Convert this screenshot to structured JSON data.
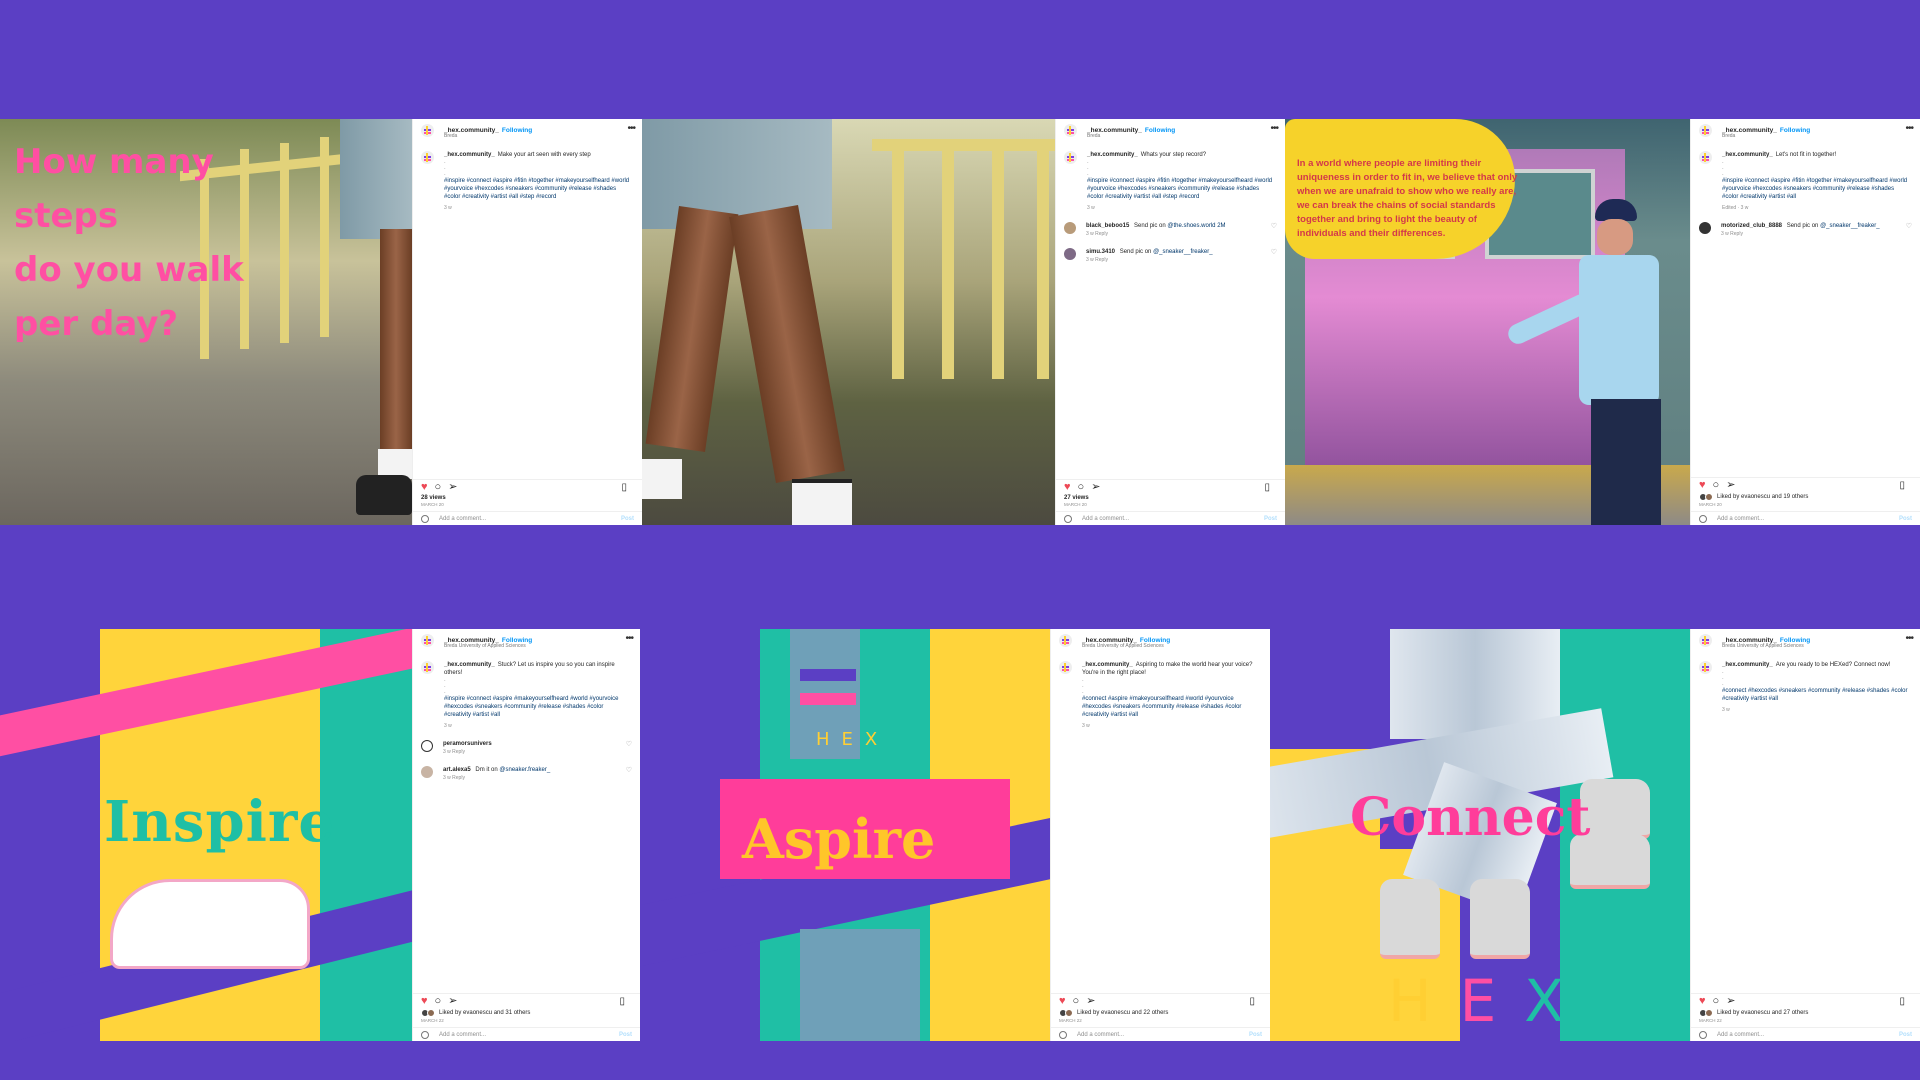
{
  "colors": {
    "background": "#5b3fc4",
    "hex_pink": "#ff4fa3",
    "hex_yellow": "#ffcf33",
    "hex_teal": "#1fbfa5",
    "hex_purple": "#5b3fc4",
    "link_blue": "#0095f6",
    "like_red": "#ed4956"
  },
  "row1": {
    "image1": {
      "overlay_lines": [
        "How many",
        "steps",
        "do you walk",
        "per day?"
      ]
    },
    "post1": {
      "username": "_hex.community_",
      "follow": "Following",
      "location": "Breda",
      "caption_user": "_hex.community_",
      "caption": "Make your art seen with every step",
      "hashtags": "#inspire #connect #aspire #fitin #together #makeyourselfheard #world #yourvoice #hexcodes #sneakers #community #release #shades #color #creativity #artist #all #step #record",
      "time": "3 w",
      "views": "28 views",
      "date": "MARCH 20",
      "add_comment": "Add a comment...",
      "post_btn": "Post"
    },
    "post2": {
      "username": "_hex.community_",
      "follow": "Following",
      "location": "Breda",
      "caption_user": "_hex.community_",
      "caption": "Whats your step record?",
      "hashtags": "#inspire #connect #aspire #fitin #together #makeyourselfheard #world #yourvoice #hexcodes #sneakers #community #release #shades #color #creativity #artist #all #step #record",
      "time": "3 w",
      "comments": [
        {
          "user": "black_beboo15",
          "text": "Send pic on",
          "mention": "@the.shoes.world 2M",
          "meta": "3 w   Reply"
        },
        {
          "user": "simu.3410",
          "text": "Send pic on",
          "mention": "@_sneaker__freaker_",
          "meta": "3 w   Reply"
        }
      ],
      "views": "27 views",
      "date": "MARCH 20",
      "add_comment": "Add a comment...",
      "post_btn": "Post"
    },
    "image3": {
      "splash_text": "In a world where people are limiting their uniqueness in order to fit in, we believe that only when we are unafraid to show who we really are, we can break the chains of social standards together and bring to light the beauty of individuals and their differences."
    },
    "post3": {
      "username": "_hex.community_",
      "follow": "Following",
      "location": "Breda",
      "caption_user": "_hex.community_",
      "caption": "Let's not fit in together!",
      "hashtags": "#inspire #connect #aspire #fitin #together #makeyourselfheard #world #yourvoice #hexcodes #sneakers #community #release #shades #color #creativity #artist #all",
      "time": "Edited · 3 w",
      "comments": [
        {
          "user": "motorized_club_8888",
          "text": "Send pic on",
          "mention": "@_sneaker__freaker_",
          "meta": "3 w   Reply"
        }
      ],
      "likes": "Liked by evaonescu and 19 others",
      "date": "MARCH 20",
      "add_comment": "Add a comment...",
      "post_btn": "Post"
    }
  },
  "row2": {
    "image1": {
      "word": "Inspire"
    },
    "post1": {
      "username": "_hex.community_",
      "follow": "Following",
      "location": "Breda University of Applied Sciences",
      "caption_user": "_hex.community_",
      "caption": "Stuck? Let us inspire you so you can inspire others!",
      "hashtags": "#inspire #connect #aspire #makeyourselfheard #world #yourvoice #hexcodes #sneakers #community #release #shades #color #creativity #artist #all",
      "time": "3 w",
      "comments": [
        {
          "user": "peramorsunivers",
          "text": "",
          "mention": "",
          "meta": "3 w   Reply"
        },
        {
          "user": "art.alexa5",
          "text": "Dm it on",
          "mention": "@sneaker.freaker_",
          "meta": "3 w   Reply"
        }
      ],
      "likes": "Liked by evaonescu and 31 others",
      "date": "MARCH 22",
      "add_comment": "Add a comment...",
      "post_btn": "Post"
    },
    "image2": {
      "word": "Aspire",
      "small_hex": "HEX"
    },
    "post2": {
      "username": "_hex.community_",
      "follow": "Following",
      "location": "Breda University of Applied Sciences",
      "caption_user": "_hex.community_",
      "caption": "Aspiring to make the world hear your voice? You're in the right place!",
      "hashtags": "#connect #aspire #makeyourselfheard #world #yourvoice #hexcodes #sneakers #community #release #shades #color #creativity #artist #all",
      "time": "3 w",
      "likes": "Liked by evaonescu and 22 others",
      "date": "MARCH 22",
      "add_comment": "Add a comment...",
      "post_btn": "Post"
    },
    "image3": {
      "word": "Connect",
      "hex_letters": [
        "H",
        "E",
        "X"
      ]
    },
    "post3": {
      "username": "_hex.community_",
      "follow": "Following",
      "location": "Breda University of Applied Sciences",
      "caption_user": "_hex.community_",
      "caption": "Are you ready to be HEXed? Connect now!",
      "hashtags": "#connect #hexcodes #sneakers #community #release #shades #color #creativity #artist #all",
      "time": "3 w",
      "likes": "Liked by evaonescu and 27 others",
      "date": "MARCH 22",
      "add_comment": "Add a comment...",
      "post_btn": "Post"
    }
  }
}
